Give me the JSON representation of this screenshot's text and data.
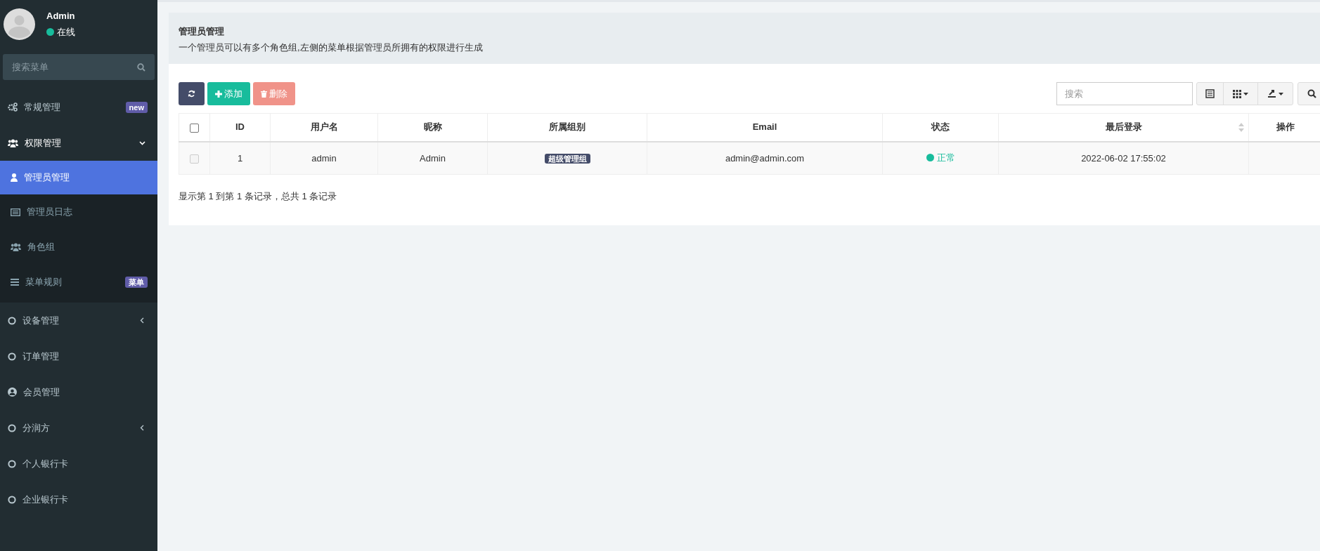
{
  "user": {
    "name": "Admin",
    "status": "在线"
  },
  "sidebar": {
    "search": {
      "placeholder": "搜索菜单"
    },
    "items": [
      {
        "label": "常规管理",
        "badge": "new",
        "selected": false
      },
      {
        "label": "权限管理",
        "expanded": true,
        "selected": false,
        "children": [
          {
            "label": "管理员管理",
            "selected": true
          },
          {
            "label": "管理员日志",
            "selected": false
          },
          {
            "label": "角色组",
            "selected": false
          },
          {
            "label": "菜单规则",
            "badge": "菜单",
            "selected": false
          }
        ]
      },
      {
        "label": "设备管理",
        "expanded": false,
        "selected": false
      },
      {
        "label": "订单管理",
        "selected": false
      },
      {
        "label": "会员管理",
        "selected": false
      },
      {
        "label": "分润方",
        "expanded": false,
        "selected": false
      },
      {
        "label": "个人银行卡",
        "selected": false
      },
      {
        "label": "企业银行卡",
        "selected": false
      }
    ]
  },
  "page": {
    "title": "管理员管理",
    "description": "一个管理员可以有多个角色组,左侧的菜单根据管理员所拥有的权限进行生成"
  },
  "toolbar": {
    "buttons": [
      {
        "kind": "refresh",
        "disabled": false
      },
      {
        "kind": "add",
        "label": "添加",
        "disabled": false
      },
      {
        "kind": "delete",
        "label": "删除",
        "disabled": true
      }
    ],
    "search": {
      "placeholder": "搜索"
    }
  },
  "table": {
    "select_all": {
      "checked": false
    },
    "columns": [
      {
        "label": "ID",
        "sortable": false
      },
      {
        "label": "用户名",
        "sortable": false
      },
      {
        "label": "昵称",
        "sortable": false
      },
      {
        "label": "所属组别",
        "sortable": false
      },
      {
        "label": "Email",
        "sortable": false
      },
      {
        "label": "状态",
        "sortable": false
      },
      {
        "label": "最后登录",
        "sortable": true
      },
      {
        "label": "操作",
        "sortable": false
      }
    ],
    "rows": [
      {
        "checked": false,
        "id": "1",
        "username": "admin",
        "nickname": "Admin",
        "group": "超级管理组",
        "email": "admin@admin.com",
        "status": "正常",
        "last_login": "2022-06-02 17:55:02"
      }
    ]
  },
  "footer": "显示第 1 到第 1 条记录，总共 1 条记录"
}
